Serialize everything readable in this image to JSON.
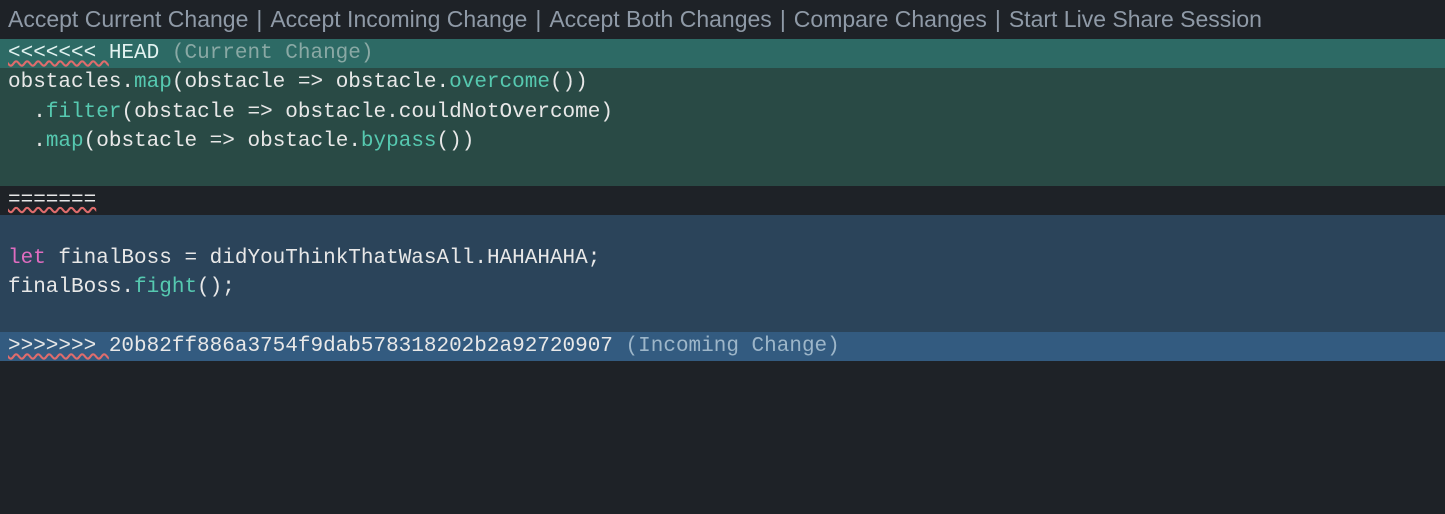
{
  "codelens": {
    "accept_current": "Accept Current Change",
    "accept_incoming": "Accept Incoming Change",
    "accept_both": "Accept Both Changes",
    "compare": "Compare Changes",
    "live_share": "Start Live Share Session",
    "sep": "|"
  },
  "conflict": {
    "current_marker": "<<<<<<< ",
    "current_ref": "HEAD",
    "current_label": "(Current Change)",
    "divider": "=======",
    "incoming_marker": ">>>>>>> ",
    "incoming_ref": "20b82ff886a3754f9dab578318202b2a92720907",
    "incoming_label": "(Incoming Change)"
  },
  "code": {
    "c1": {
      "obj": "obstacles",
      "dot": ".",
      "map": "map",
      "open": "(",
      "param": "obstacle ",
      "arrow": "=> ",
      "param2": "obstacle",
      "dot2": ".",
      "call": "overcome",
      "close": "())"
    },
    "c2": {
      "indent": "  ",
      "dot": ".",
      "filter": "filter",
      "open": "(",
      "param": "obstacle ",
      "arrow": "=> ",
      "param2": "obstacle",
      "dot2": ".",
      "prop": "couldNotOvercome",
      "close": ")"
    },
    "c3": {
      "indent": "  ",
      "dot": ".",
      "map": "map",
      "open": "(",
      "param": "obstacle ",
      "arrow": "=> ",
      "param2": "obstacle",
      "dot2": ".",
      "call": "bypass",
      "close": "())"
    },
    "i1": {
      "let": "let ",
      "var": "finalBoss ",
      "eq": "= ",
      "obj": "didYouThinkThatWasAll",
      "dot": ".",
      "prop": "HAHAHAHA",
      "semi": ";"
    },
    "i2": {
      "obj": "finalBoss",
      "dot": ".",
      "call": "fight",
      "close": "();"
    }
  }
}
